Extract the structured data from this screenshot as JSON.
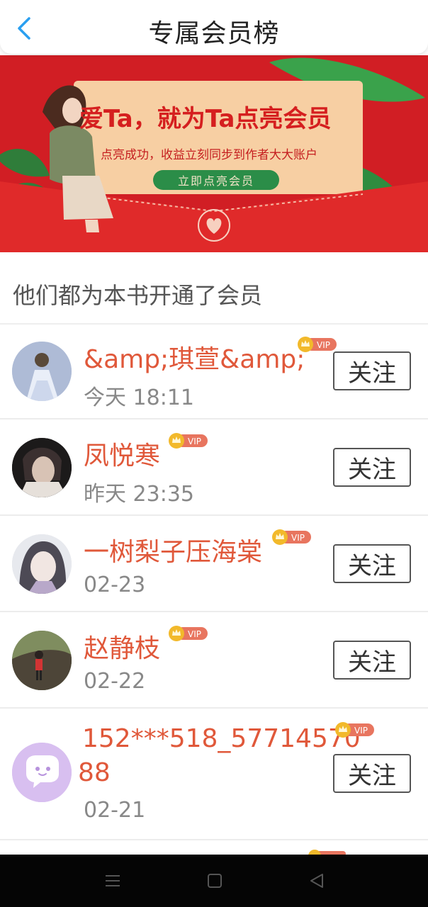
{
  "header": {
    "title": "专属会员榜",
    "back_icon": "chevron-left-icon",
    "accent": "#2a9ff0"
  },
  "banner": {
    "headline": "爱Ta，就为Ta点亮会员",
    "subtitle": "点亮成功，收益立刻同步到作者大大账户",
    "cta": "立即点亮会员",
    "background": "#d11e24"
  },
  "section": {
    "title": "他们都为本书开通了会员"
  },
  "members": [
    {
      "name": "&amp;琪萱&amp;",
      "time": "今天 18:11",
      "badge": "VIP",
      "follow": "关注"
    },
    {
      "name": "凤悦寒",
      "time": "昨天 23:35",
      "badge": "VIP",
      "follow": "关注"
    },
    {
      "name": "一树梨子压海棠",
      "time": "02-23",
      "badge": "VIP",
      "follow": "关注"
    },
    {
      "name": "赵静枝",
      "time": "02-22",
      "badge": "VIP",
      "follow": "关注"
    },
    {
      "name_line1": "152***518_57714570",
      "name_line2": "88",
      "time": "02-21",
      "badge": "VIP",
      "follow": "关注"
    }
  ],
  "colors": {
    "name": "#e0583a",
    "vip_badge": "#e8755f",
    "crown": "#f2b92b"
  }
}
